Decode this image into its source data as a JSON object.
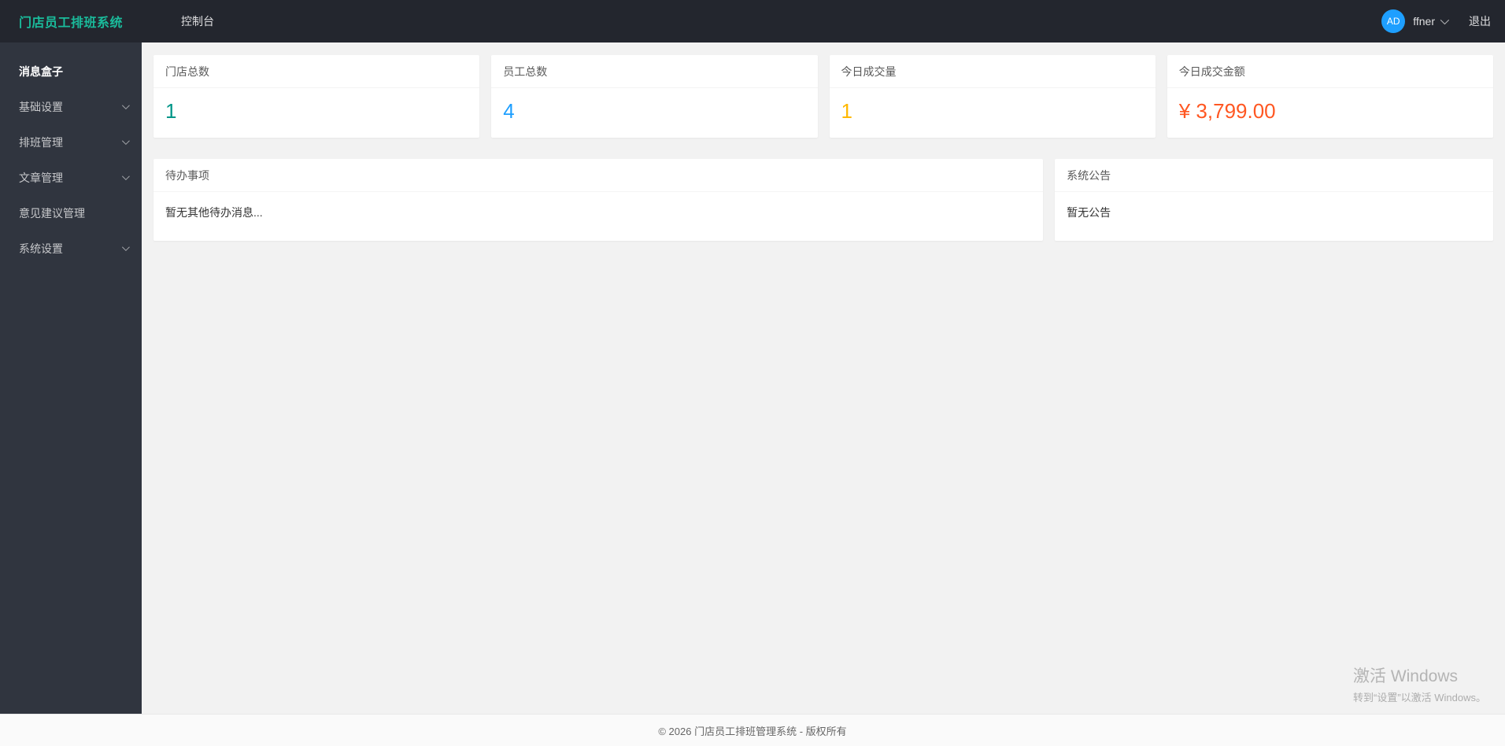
{
  "header": {
    "brand": "门店员工排班系统",
    "nav": [
      {
        "label": "控制台"
      }
    ],
    "user": {
      "avatar_initials": "AD",
      "username": "ffner",
      "logout_label": "退出"
    },
    "colors": {
      "brand_accent": "#1abc9c",
      "avatar_bg": "#1E9FFF"
    }
  },
  "sidebar": {
    "items": [
      {
        "label": "消息盒子",
        "expandable": false,
        "active": true
      },
      {
        "label": "基础设置",
        "expandable": true
      },
      {
        "label": "排班管理",
        "expandable": true
      },
      {
        "label": "文章管理",
        "expandable": true
      },
      {
        "label": "意见建议管理",
        "expandable": false
      },
      {
        "label": "系统设置",
        "expandable": true
      }
    ]
  },
  "stats": [
    {
      "title": "门店总数",
      "value": "1",
      "color": "#009688"
    },
    {
      "title": "员工总数",
      "value": "4",
      "color": "#1E9FFF"
    },
    {
      "title": "今日成交量",
      "value": "1",
      "color": "#FFB800"
    },
    {
      "title": "今日成交金额",
      "value": "¥ 3,799.00",
      "color": "#FF5722"
    }
  ],
  "panels": {
    "todo": {
      "title": "待办事项",
      "body": "暂无其他待办消息..."
    },
    "notice": {
      "title": "系统公告",
      "body": "暂无公告"
    }
  },
  "footer": {
    "copyright": "© 2026 门店员工排班管理系统 - 版权所有"
  },
  "watermark": {
    "line1": "激活 Windows",
    "line2": "转到“设置”以激活 Windows。"
  }
}
